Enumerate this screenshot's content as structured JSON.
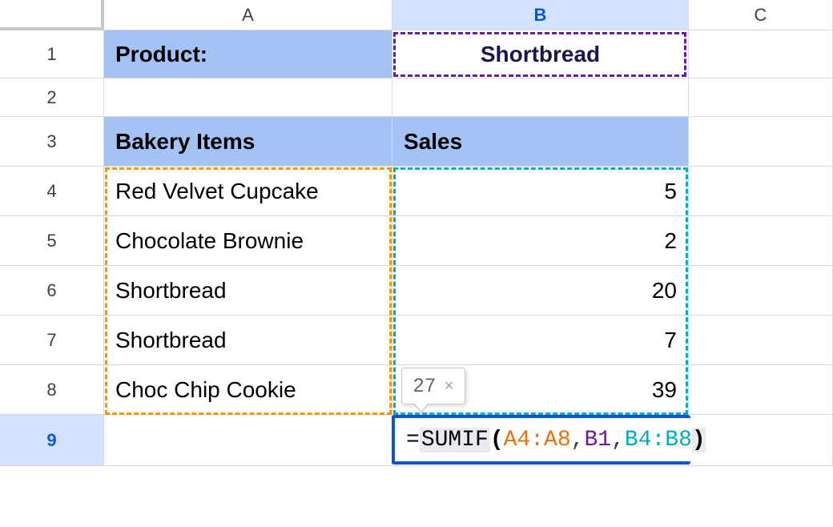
{
  "columns": {
    "A": "A",
    "B": "B",
    "C": "C"
  },
  "rowLabels": {
    "r1": "1",
    "r2": "2",
    "r3": "3",
    "r4": "4",
    "r5": "5",
    "r6": "6",
    "r7": "7",
    "r8": "8",
    "r9": "9"
  },
  "cells": {
    "A1": "Product:",
    "B1": "Shortbread",
    "A3": "Bakery Items",
    "B3": "Sales",
    "A4": "Red Velvet Cupcake",
    "B4": "5",
    "A5": "Chocolate Brownie",
    "B5": "2",
    "A6": "Shortbread",
    "B6": "20",
    "A7": "Shortbread",
    "B7": "7",
    "A8": "Choc Chip Cookie",
    "B8": "39"
  },
  "formula": {
    "eq": "=",
    "fn": "SUMIF",
    "open": "(",
    "arg1": "A4:A8",
    "c1": ",",
    "arg2": "B1",
    "c2": ",",
    "arg3": "B4:B8",
    "close": ")"
  },
  "tooltip": {
    "value": "27",
    "close": "×"
  }
}
